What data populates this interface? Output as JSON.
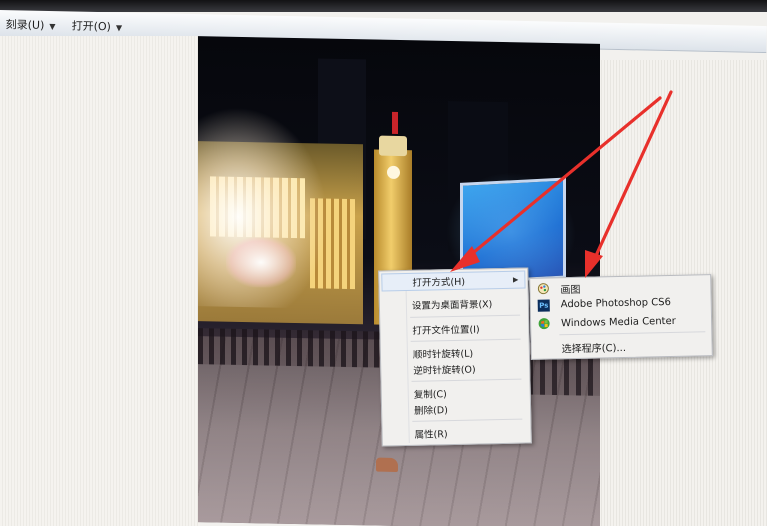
{
  "toolbar": {
    "burn_label": "刻录(U)",
    "open_label": "打开(O)"
  },
  "context_menu": {
    "open_with": "打开方式(H)",
    "set_desktop_bg": "设置为桌面背景(X)",
    "open_file_location": "打开文件位置(I)",
    "rotate_clockwise": "顺时针旋转(L)",
    "rotate_counterclockwise": "逆时针旋转(O)",
    "copy": "复制(C)",
    "delete": "删除(D)",
    "properties": "属性(R)"
  },
  "submenu": {
    "paint": "画图",
    "photoshop": "Adobe Photoshop CS6",
    "wmc": "Windows Media Center",
    "choose_program": "选择程序(C)..."
  },
  "icons": {
    "paint": "paint-icon",
    "photoshop": "photoshop-icon",
    "wmc": "windows-media-center-icon",
    "submenu_arrow": "submenu-arrow-icon"
  },
  "colors": {
    "annotation_arrow": "#e8302b",
    "menu_background": "#f1f0ee",
    "menu_highlight": "#e7eef8"
  }
}
